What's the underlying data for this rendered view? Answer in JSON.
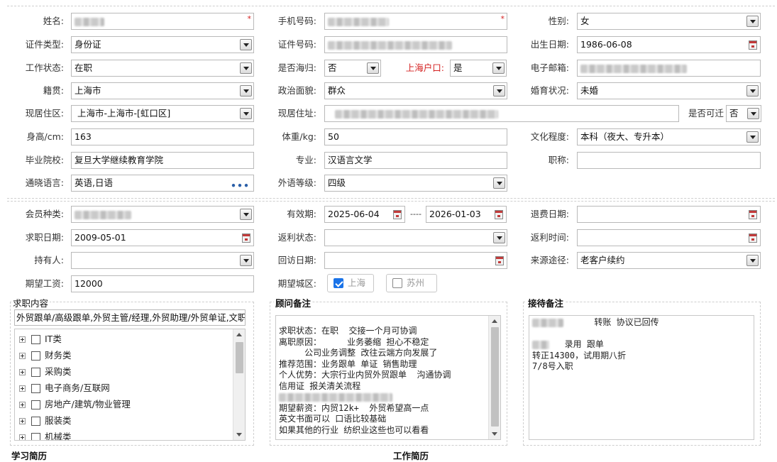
{
  "basic": {
    "name_label": "姓名:",
    "phone_label": "手机号码:",
    "gender_label": "性别:",
    "gender_value": "女",
    "id_type_label": "证件类型:",
    "id_type_value": "身份证",
    "id_number_label": "证件号码:",
    "birth_label": "出生日期:",
    "birth_value": "1986-06-08",
    "work_status_label": "工作状态:",
    "work_status_value": "在职",
    "overseas_label": "是否海归:",
    "overseas_value": "否",
    "hukou_label": "上海户口:",
    "hukou_value": "是",
    "email_label": "电子邮箱:",
    "native_label": "籍贯:",
    "native_value": "上海市",
    "political_label": "政治面貌:",
    "political_value": "群众",
    "marital_label": "婚育状况:",
    "marital_value": "未婚",
    "residence_label": "现居住区:",
    "residence_value": "上海市-上海市-[虹口区]",
    "address_label": "现居住址:",
    "relocate_label": "是否可迁",
    "relocate_value": "否",
    "height_label": "身高/cm:",
    "height_value": "163",
    "weight_label": "体重/kg:",
    "weight_value": "50",
    "education_label": "文化程度:",
    "education_value": "本科（夜大、专升本）",
    "school_label": "毕业院校:",
    "school_value": "复旦大学继续教育学院",
    "major_label": "专业:",
    "major_value": "汉语言文学",
    "title_label": "职称:",
    "title_value": "",
    "language_label": "通晓语言:",
    "language_value": "英语,日语",
    "lang_level_label": "外语等级:",
    "lang_level_value": "四级"
  },
  "membership": {
    "member_type_label": "会员种类:",
    "validity_label": "有效期:",
    "validity_start": "2025-06-04",
    "validity_sep": "----",
    "validity_end": "2026-01-03",
    "refund_date_label": "退费日期:",
    "job_date_label": "求职日期:",
    "job_date_value": "2009-05-01",
    "rebate_status_label": "返利状态:",
    "rebate_time_label": "返利时间:",
    "holder_label": "持有人:",
    "revisit_label": "回访日期:",
    "source_label": "来源途径:",
    "source_value": "老客户续约",
    "salary_label": "期望工资:",
    "salary_value": "12000",
    "city_label": "期望城区:",
    "city_options": [
      {
        "label": "上海",
        "checked": true
      },
      {
        "label": "苏州",
        "checked": false
      }
    ]
  },
  "job_content": {
    "title": "求职内容",
    "summary": "外贸跟单/高级跟单,外贸主管/经理,外贸助理/外贸单证,文职",
    "tree": [
      "IT类",
      "财务类",
      "采购类",
      "电子商务/互联网",
      "房地产/建筑/物业管理",
      "服装类",
      "机械类"
    ]
  },
  "consultant_note": {
    "title": "顾问备注",
    "lines": [
      "求职状态：在职  交接一个月可协调",
      "离职原因：     业务萎缩 担心不稳定",
      "     公司业务调整 改往云端方向发展了",
      "推荐范围：业务跟单 单证 销售助理",
      "个人优势：大宗行业内贸外贸跟单  沟通协调",
      "信用证 报关清关流程",
      "",
      "期望薪资：内贸12k+  外贸希望高一点",
      "英文书面可以 口语比较基础",
      "如果其他的行业 纺织业这些也可以看看"
    ]
  },
  "reception_note": {
    "title": "接待备注",
    "lines": [
      "      转账 协议已回传",
      "",
      "   录用 跟单",
      "转正14300，试用期八折",
      "7/8号入职"
    ]
  },
  "bottom_partial": {
    "left": "学习简历",
    "mid": "工作简历"
  }
}
